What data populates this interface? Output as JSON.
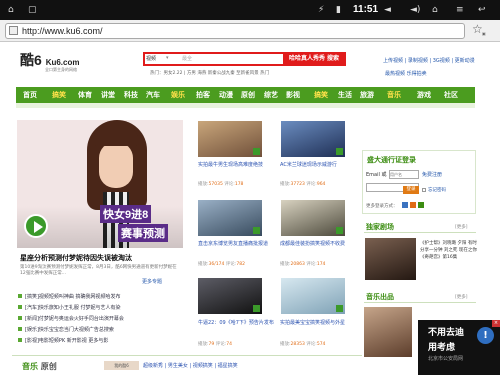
{
  "status": {
    "time": "11:51"
  },
  "browser": {
    "url": "http://www.ku6.com/"
  },
  "header": {
    "logo_text": "酷6",
    "logo_brand": "Ku6.com",
    "logo_sub": "全口第主身的网络",
    "search_tabs": "视频",
    "search_select": "视频",
    "search_placeholder": "最全",
    "search_button": "哈哈真人秀秀 搜索",
    "hot_words": "热门：男女2.22  | 方男  海燕  新秦公战九秦  至新雀风景  热门",
    "upload_links": "上传视频 | 录制视频 | 3G视频 | 更新动漫",
    "upload_links2": "最热视频                   乐得拍卖"
  },
  "nav": [
    "首页",
    "搞笑",
    "体育",
    "讲堂",
    "科技",
    "汽车",
    "娱乐",
    "拍客",
    "动漫",
    "原创",
    "综艺",
    "影视",
    "搞笑",
    "生活",
    "旅游",
    "音乐",
    "游戏",
    "社区"
  ],
  "feature": {
    "tag1": "快女9进8",
    "tag2": "赛事预测",
    "title": "星座分析预测付梦妮待因失误被淘汰",
    "desc": "第10进9淘汰赛预测付梦妮发挥正常，8月3日，酷6网快男通道有更新付梦妮在12强比赛中发挥正常...",
    "more": "更多专题"
  },
  "news": [
    "[搞笑]视频短频叫神曲 搞确我网视频哈发布",
    "[汽车]快乐旅知小王礼服 付梦妮与艺人有染",
    "[新闻]付梦妮与奥运会火好手同台出演开幕会",
    "[娱乐]快乐宝宝恋当门大视频广告总搜索",
    "[影视]电影短频PK 新开影视 更多与影"
  ],
  "thumbs": [
    {
      "cap": "实拍最牛男生现场高难度绝技",
      "meta": "播放:",
      "plays": "57035",
      "cmt": "评论:",
      "cmts": "178"
    },
    {
      "cap": "AC米兰球迷现场示威游行",
      "meta": "播放:",
      "plays": "37723",
      "cmts": "964",
      "cmt": "评论:"
    },
    {
      "cap": "直击京东博览男友直播痛批报道",
      "meta": "播放:",
      "plays": "36/174",
      "cmt": "评论:",
      "cmts": "782"
    },
    {
      "cap": "成都最佳装扮搞笑视频不收费",
      "meta": "播放:",
      "plays": "20863",
      "cmt": "评论:",
      "cmts": "174"
    },
    {
      "cap": "牛逼22：09《哈7下》预告片发布",
      "meta": "播放:",
      "plays": "79",
      "cmt": "评论:",
      "cmts": "74"
    },
    {
      "cap": "实拍最美宝宝搞笑视频与外星",
      "meta": "播放:",
      "plays": "28353",
      "cmt": "评论:",
      "cmts": "574"
    }
  ],
  "login": {
    "title": "盛大通行证登录",
    "email_label": "Email 或",
    "email_placeholder": "用户名",
    "register": "免费注册",
    "login_button": "登录",
    "remember": "忘记密码",
    "more_login": "更多登录方式："
  },
  "drama": {
    "title": "独家剧场",
    "more": "[更多]",
    "text": "《护士帮》刘晓璐 夕阳 有时分享一分钟 刘之死 现在之你《奇葩宫》第16集"
  },
  "music": {
    "title": "音乐出品",
    "more": "[更多]"
  },
  "pixel_ad": {
    "line1": "不用去迪",
    "line2": "用考虑",
    "line3": "北京市公安局网"
  },
  "bottom": {
    "tab1": "音乐",
    "tab2": "原创",
    "logo": "我的酷6",
    "links": "超级新秀 | 男生美女 | 视频搞笑 | 福星搞笑"
  },
  "colors": {
    "nav_green": "#4b9c1f",
    "search_red": "#e01b1b",
    "brand_green": "#3c8d12"
  }
}
